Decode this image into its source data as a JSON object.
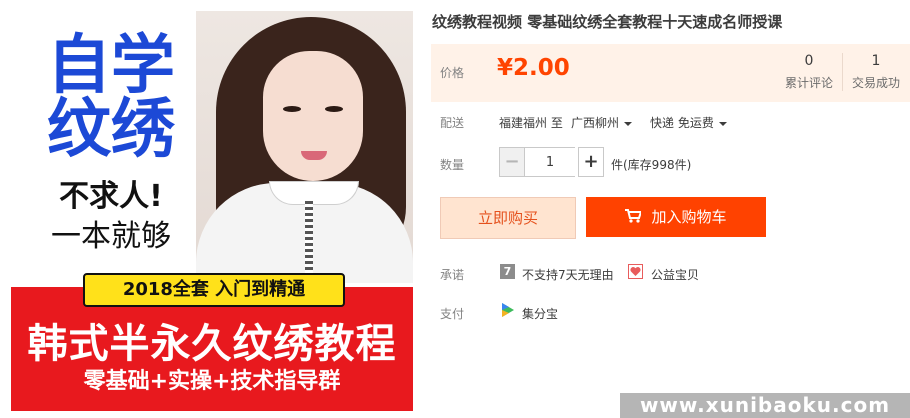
{
  "image": {
    "headline_1": "自学",
    "headline_2": "纹绣",
    "headline_3": "不求人!",
    "headline_4": "一本就够",
    "banner_yellow": "2018全套 入门到精通",
    "banner_main": "韩式半永久纹绣教程",
    "banner_sub": "零基础+实操+技术指导群"
  },
  "product": {
    "title": "纹绣教程视频 零基础纹绣全套教程十天速成名师授课"
  },
  "price": {
    "label": "价格",
    "value": "¥2.00",
    "color": "#ff4400"
  },
  "stats": [
    {
      "count": "0",
      "label": "累计评论"
    },
    {
      "count": "1",
      "label": "交易成功"
    }
  ],
  "delivery": {
    "label": "配送",
    "origin": "福建福州 至",
    "destination": "广西柳州",
    "method": "快递 免运费"
  },
  "quantity": {
    "label": "数量",
    "minus": "−",
    "value": "1",
    "plus": "+",
    "stock": "件(库存998件)"
  },
  "actions": {
    "buy_now": "立即购买",
    "add_to_cart": "加入购物车",
    "accent": "#ff4200"
  },
  "promise": {
    "label": "承诺",
    "icon_7_text": "7",
    "no_return": "不支持7天无理由",
    "charity": "公益宝贝"
  },
  "payment": {
    "label": "支付",
    "method": "集分宝"
  },
  "watermark": {
    "text": "www.xunibaoku.com"
  }
}
